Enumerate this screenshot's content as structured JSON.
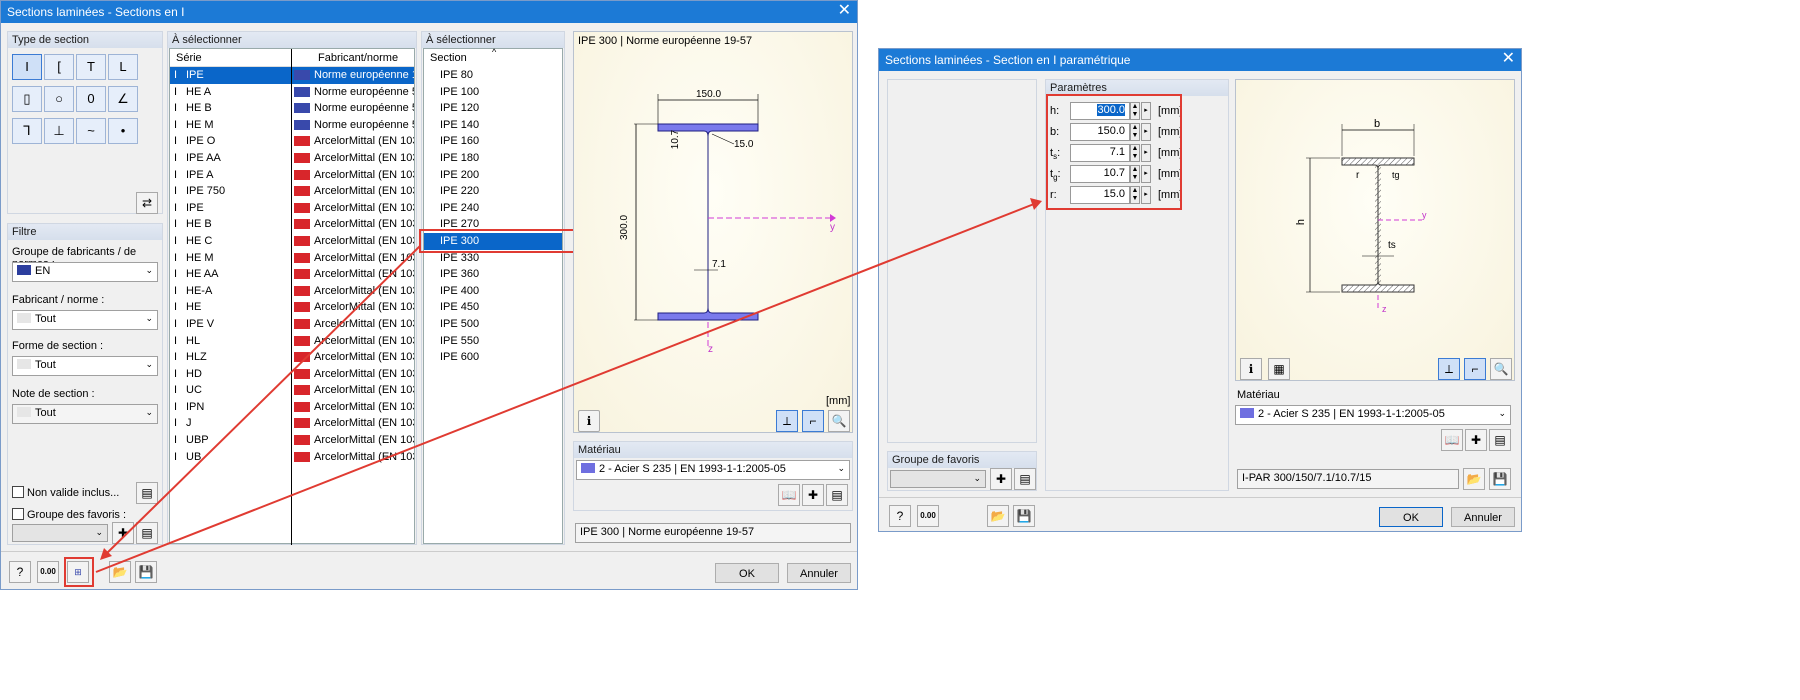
{
  "win1": {
    "title": "Sections laminées - Sections en I",
    "section_type": {
      "label": "Type de section",
      "icons": [
        "i-section-icon",
        "c-section-icon",
        "t-section-icon",
        "l-section-icon",
        "rect-hollow-icon",
        "circle-hollow-icon",
        "oval-hollow-icon",
        "angle-icon",
        "z-section-icon",
        "rail-icon",
        "sheet-pile-icon",
        "bulb-icon",
        "swap-icon"
      ]
    },
    "filter": {
      "label": "Filtre",
      "group_label": "Groupe de fabricants / de normes :",
      "group_value": "EN",
      "maker_label": "Fabricant / norme :",
      "maker_value": "Tout",
      "shape_label": "Forme de section :",
      "shape_value": "Tout",
      "note_label": "Note de section :",
      "note_value": "Tout",
      "invalid_label": "Non valide inclus...",
      "fav_label": "Groupe des favoris :"
    },
    "list1": {
      "header": "À sélectionner",
      "col1": "Série",
      "col2": "Fabricant/norme",
      "rows": [
        {
          "s": "IPE",
          "m": "Norme européenne 19-"
        },
        {
          "s": "HE A",
          "m": "Norme européenne 53-€"
        },
        {
          "s": "HE B",
          "m": "Norme européenne 53-€"
        },
        {
          "s": "HE M",
          "m": "Norme européenne 53-€"
        },
        {
          "s": "IPE O",
          "m": "ArcelorMittal (EN 10365"
        },
        {
          "s": "IPE AA",
          "m": "ArcelorMittal (EN 10365"
        },
        {
          "s": "IPE A",
          "m": "ArcelorMittal (EN 10365"
        },
        {
          "s": "IPE 750",
          "m": "ArcelorMittal (EN 10365"
        },
        {
          "s": "IPE",
          "m": "ArcelorMittal (EN 10365"
        },
        {
          "s": "HE B",
          "m": "ArcelorMittal (EN 10365"
        },
        {
          "s": "HE C",
          "m": "ArcelorMittal (EN 10365"
        },
        {
          "s": "HE M",
          "m": "ArcelorMittal (EN 10365"
        },
        {
          "s": "HE AA",
          "m": "ArcelorMittal (EN 10365"
        },
        {
          "s": "HE-A",
          "m": "ArcelorMittal (EN 10365"
        },
        {
          "s": "HE",
          "m": "ArcelorMittal (EN 10365"
        },
        {
          "s": "IPE V",
          "m": "ArcelorMittal (EN 10365"
        },
        {
          "s": "HL",
          "m": "ArcelorMittal (EN 10365"
        },
        {
          "s": "HLZ",
          "m": "ArcelorMittal (EN 10365"
        },
        {
          "s": "HD",
          "m": "ArcelorMittal (EN 10365"
        },
        {
          "s": "UC",
          "m": "ArcelorMittal (EN 10365"
        },
        {
          "s": "IPN",
          "m": "ArcelorMittal (EN 10365"
        },
        {
          "s": "J",
          "m": "ArcelorMittal (EN 10365"
        },
        {
          "s": "UBP",
          "m": "ArcelorMittal (EN 10365"
        },
        {
          "s": "UB",
          "m": "ArcelorMittal (EN 10365"
        }
      ]
    },
    "list2": {
      "header": "À sélectionner",
      "col": "Section",
      "rows": [
        "IPE 80",
        "IPE 100",
        "IPE 120",
        "IPE 140",
        "IPE 160",
        "IPE 180",
        "IPE 200",
        "IPE 220",
        "IPE 240",
        "IPE 270",
        "IPE 300",
        "IPE 330",
        "IPE 360",
        "IPE 400",
        "IPE 450",
        "IPE 500",
        "IPE 550",
        "IPE 600"
      ],
      "selected": "IPE 300"
    },
    "preview": {
      "caption": "IPE 300 | Norme européenne 19-57",
      "dim_b": "150.0",
      "dim_h": "300.0",
      "dim_tf": "10.7",
      "dim_r": "15.0",
      "dim_tw": "7.1",
      "axis_y": "y",
      "axis_z": "z",
      "unit": "[mm]"
    },
    "material": {
      "label": "Matériau",
      "value": "2 - Acier S 235 | EN 1993-1-1:2005-05",
      "color": "#6f6fe0"
    },
    "result": "IPE 300 | Norme européenne 19-57",
    "ok": "OK",
    "cancel": "Annuler",
    "calc_icon": "0.00"
  },
  "win2": {
    "title": "Sections laminées - Section en I paramétrique",
    "params": {
      "label": "Paramètres",
      "unit": "[mm]",
      "rows": [
        {
          "k": "h",
          "sub": "",
          "v": "300.0"
        },
        {
          "k": "b",
          "sub": "",
          "v": "150.0"
        },
        {
          "k": "t",
          "sub": "s",
          "v": "7.1"
        },
        {
          "k": "t",
          "sub": "g",
          "v": "10.7"
        },
        {
          "k": "r",
          "sub": "",
          "v": "15.0"
        }
      ]
    },
    "fav_label": "Groupe de favoris",
    "preview": {
      "b": "b",
      "h": "h",
      "r": "r",
      "tg": "tg",
      "ts": "ts",
      "y": "y",
      "z": "z"
    },
    "material": {
      "label": "Matériau",
      "value": "2 - Acier S 235 | EN 1993-1-1:2005-05"
    },
    "result": "I-PAR 300/150/7.1/10.7/15",
    "ok": "OK",
    "cancel": "Annuler",
    "calc_icon": "0.00"
  }
}
